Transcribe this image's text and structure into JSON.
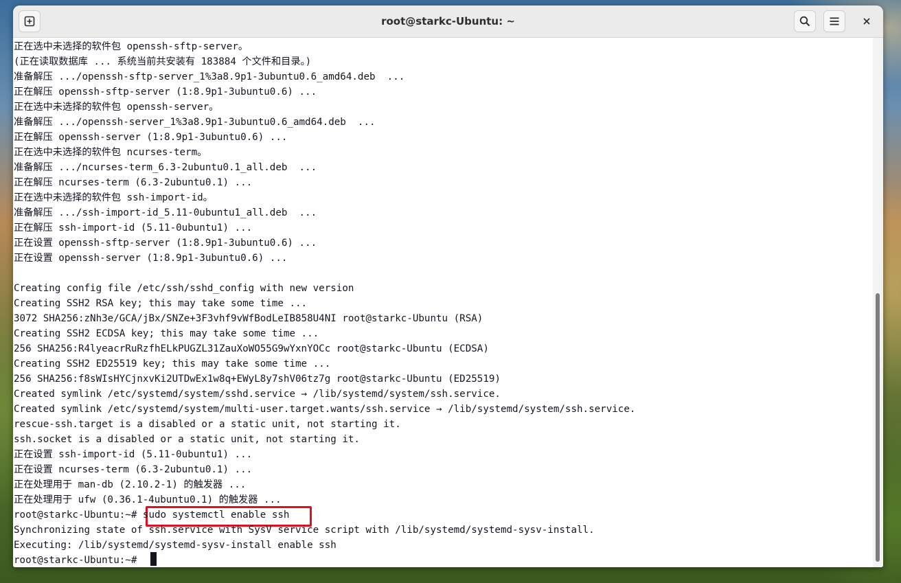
{
  "window": {
    "title": "root@starkc-Ubuntu: ~",
    "buttons": {
      "new_tab": "new-tab-icon",
      "search": "search-icon",
      "menu": "hamburger-menu-icon",
      "close": "close-icon"
    }
  },
  "terminal": {
    "lines": [
      "正在选中未选择的软件包 openssh-sftp-server。",
      "(正在读取数据库 ... 系统当前共安装有 183884 个文件和目录。)",
      "准备解压 .../openssh-sftp-server_1%3a8.9p1-3ubuntu0.6_amd64.deb  ...",
      "正在解压 openssh-sftp-server (1:8.9p1-3ubuntu0.6) ...",
      "正在选中未选择的软件包 openssh-server。",
      "准备解压 .../openssh-server_1%3a8.9p1-3ubuntu0.6_amd64.deb  ...",
      "正在解压 openssh-server (1:8.9p1-3ubuntu0.6) ...",
      "正在选中未选择的软件包 ncurses-term。",
      "准备解压 .../ncurses-term_6.3-2ubuntu0.1_all.deb  ...",
      "正在解压 ncurses-term (6.3-2ubuntu0.1) ...",
      "正在选中未选择的软件包 ssh-import-id。",
      "准备解压 .../ssh-import-id_5.11-0ubuntu1_all.deb  ...",
      "正在解压 ssh-import-id (5.11-0ubuntu1) ...",
      "正在设置 openssh-sftp-server (1:8.9p1-3ubuntu0.6) ...",
      "正在设置 openssh-server (1:8.9p1-3ubuntu0.6) ...",
      "",
      "Creating config file /etc/ssh/sshd_config with new version",
      "Creating SSH2 RSA key; this may take some time ...",
      "3072 SHA256:zNh3e/GCA/jBx/SNZe+3F3vhf9vWfBodLeIB858U4NI root@starkc-Ubuntu (RSA)",
      "Creating SSH2 ECDSA key; this may take some time ...",
      "256 SHA256:R4lyeacrRuRzfhELkPUGZL31ZauXoWO55G9wYxnYOCc root@starkc-Ubuntu (ECDSA)",
      "Creating SSH2 ED25519 key; this may take some time ...",
      "256 SHA256:f8sWIsHYCjnxvKi2UTDwEx1w8q+EWyL8y7shV06tz7g root@starkc-Ubuntu (ED25519)",
      "Created symlink /etc/systemd/system/sshd.service → /lib/systemd/system/ssh.service.",
      "Created symlink /etc/systemd/system/multi-user.target.wants/ssh.service → /lib/systemd/system/ssh.service.",
      "rescue-ssh.target is a disabled or a static unit, not starting it.",
      "ssh.socket is a disabled or a static unit, not starting it.",
      "正在设置 ssh-import-id (5.11-0ubuntu1) ...",
      "正在设置 ncurses-term (6.3-2ubuntu0.1) ...",
      "正在处理用于 man-db (2.10.2-1) 的触发器 ...",
      "正在处理用于 ufw (0.36.1-4ubuntu0.1) 的触发器 ...",
      "root@starkc-Ubuntu:~# sudo systemctl enable ssh",
      "Synchronizing state of ssh.service with SysV service script with /lib/systemd/systemd-sysv-install.",
      "Executing: /lib/systemd/systemd-sysv-install enable ssh",
      "root@starkc-Ubuntu:~# "
    ],
    "highlighted_command": "sudo systemctl enable ssh",
    "highlight_color": "#e0101e"
  },
  "colors": {
    "titlebar": "#ebebeb",
    "terminal_bg": "#ffffff",
    "terminal_fg": "#171421"
  }
}
